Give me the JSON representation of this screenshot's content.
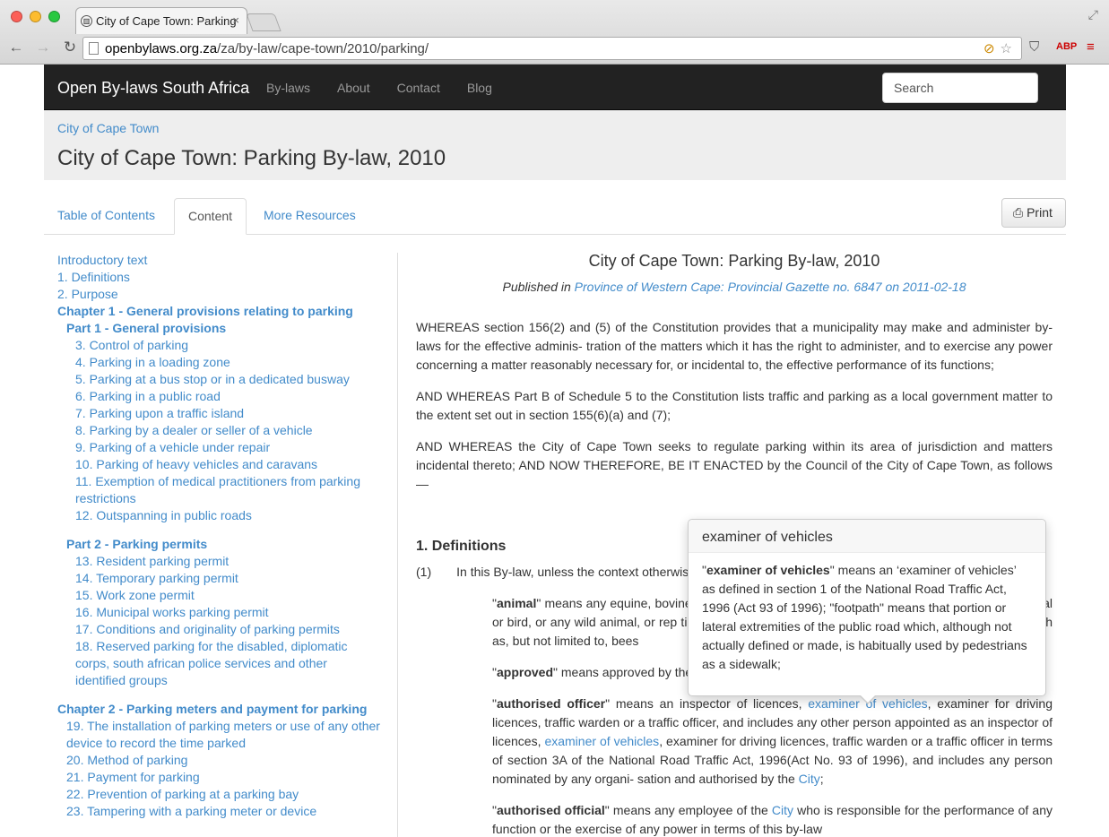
{
  "browser": {
    "tab_title": "City of Cape Town: Parking",
    "url_host": "openbylaws.org.za",
    "url_path": "/za/by-law/cape-town/2010/parking/"
  },
  "navbar": {
    "brand": "Open By-laws South Africa",
    "links": [
      "By-laws",
      "About",
      "Contact",
      "Blog"
    ],
    "search_placeholder": "Search"
  },
  "header": {
    "breadcrumb": "City of Cape Town",
    "title": "City of Cape Town: Parking By-law, 2010"
  },
  "tabs": [
    "Table of Contents",
    "Content",
    "More Resources"
  ],
  "print_label": "Print",
  "toc": {
    "intro": "Introductory text",
    "s1": "1. Definitions",
    "s2": "2. Purpose",
    "ch1": "Chapter 1 - General provisions relating to parking",
    "pt1": "Part 1 - General provisions",
    "pt1_items": [
      "3. Control of parking",
      "4. Parking in a loading zone",
      "5. Parking at a bus stop or in a dedicated busway",
      "6. Parking in a public road",
      "7. Parking upon a traffic island",
      "8. Parking by a dealer or seller of a vehicle",
      "9. Parking of a vehicle under repair",
      "10. Parking of heavy vehicles and caravans",
      "11. Exemption of medical practitioners from parking restrictions",
      "12. Outspanning in public roads"
    ],
    "pt2": "Part 2 - Parking permits",
    "pt2_items": [
      "13. Resident parking permit",
      "14. Temporary parking permit",
      "15. Work zone permit",
      "16. Municipal works parking permit",
      "17. Conditions and originality of parking permits",
      "18. Reserved parking for the disabled, diplomatic corps, south african police services and other identified groups"
    ],
    "ch2": "Chapter 2 - Parking meters and payment for parking",
    "ch2_items": [
      "19. The installation of parking meters or use of any other device to record the time parked",
      "20. Method of parking",
      "21. Payment for parking",
      "22. Prevention of parking at a parking bay",
      "23. Tampering with a parking meter or device"
    ]
  },
  "content": {
    "title": "City of Cape Town: Parking By-law, 2010",
    "published_prefix": "Published in ",
    "published_link": "Province of Western Cape: Provincial Gazette no. 6847 on 2011-02-18",
    "para1": "WHEREAS section 156(2) and (5) of the Constitution provides that a municipality may make and administer by-laws for the effective adminis- tration of the matters which it has the right to administer, and to exercise any power concerning a matter reasonably necessary for, or incidental to, the effective performance of its functions;",
    "para2": "AND WHEREAS Part B of Schedule 5 to the Constitution lists traffic and parking as a local government matter to the extent set out in section 155(6)(a) and (7);",
    "para3": "AND WHEREAS the City of Cape Town seeks to regulate parking within its area of jurisdiction and matters incidental thereto; AND NOW THEREFORE, BE IT ENACTED by the Council of the City of Cape Town, as follows —",
    "section_heading": "1. Definitions",
    "sub_num": "(1)",
    "sub_text": "In this By-law, unless the context otherwis",
    "def_animal_term": "animal",
    "def_animal_text": " means any equine, bovine, caprine, ovine, porcine, canine, feline, or other domestic animal or bird, or any wild animal, or rep tile, and for the purposes of this By-law also includes insects, such as, but not limited to, bees",
    "def_approved_term": "approved",
    "def_approved_text": " means approved by the City;",
    "def_officer_term": "authorised officer",
    "def_officer_a": " means an inspector of licences, ",
    "def_officer_link1": "examiner of vehicles",
    "def_officer_b": ", examiner for driving licences, traffic warden or a traffic officer, and includes any other person appointed as an inspector of licences, ",
    "def_officer_link2": "examiner of vehicles",
    "def_officer_c": ", examiner for driving licences, traffic warden or a traffic officer in terms of section 3A of the National Road Traffic Act, 1996(Act No. 93 of 1996), and includes any person nominated by any organi- sation and authorised by the ",
    "def_officer_link3": "City",
    "def_officer_d": ";",
    "def_official_term": "authorised official",
    "def_official_a": " means any employee of the ",
    "def_official_link": "City",
    "def_official_b": " who is responsible for the performance of any function or the exercise of any power in terms of this by-law"
  },
  "popover": {
    "title": "examiner of vehicles",
    "term": "examiner of vehicles",
    "text": " means an ‘examiner of vehicles’ as defined in section 1 of the National Road Traffic Act, 1996 (Act 93 of 1996); \"footpath\" means that portion or lateral extremities of the public road which, although not actually defined or made, is habitually used by pedestrians as a sidewalk;"
  },
  "colors": {
    "link": "#428bca",
    "navbar": "#222222",
    "jumbotron": "#eeeeee"
  }
}
